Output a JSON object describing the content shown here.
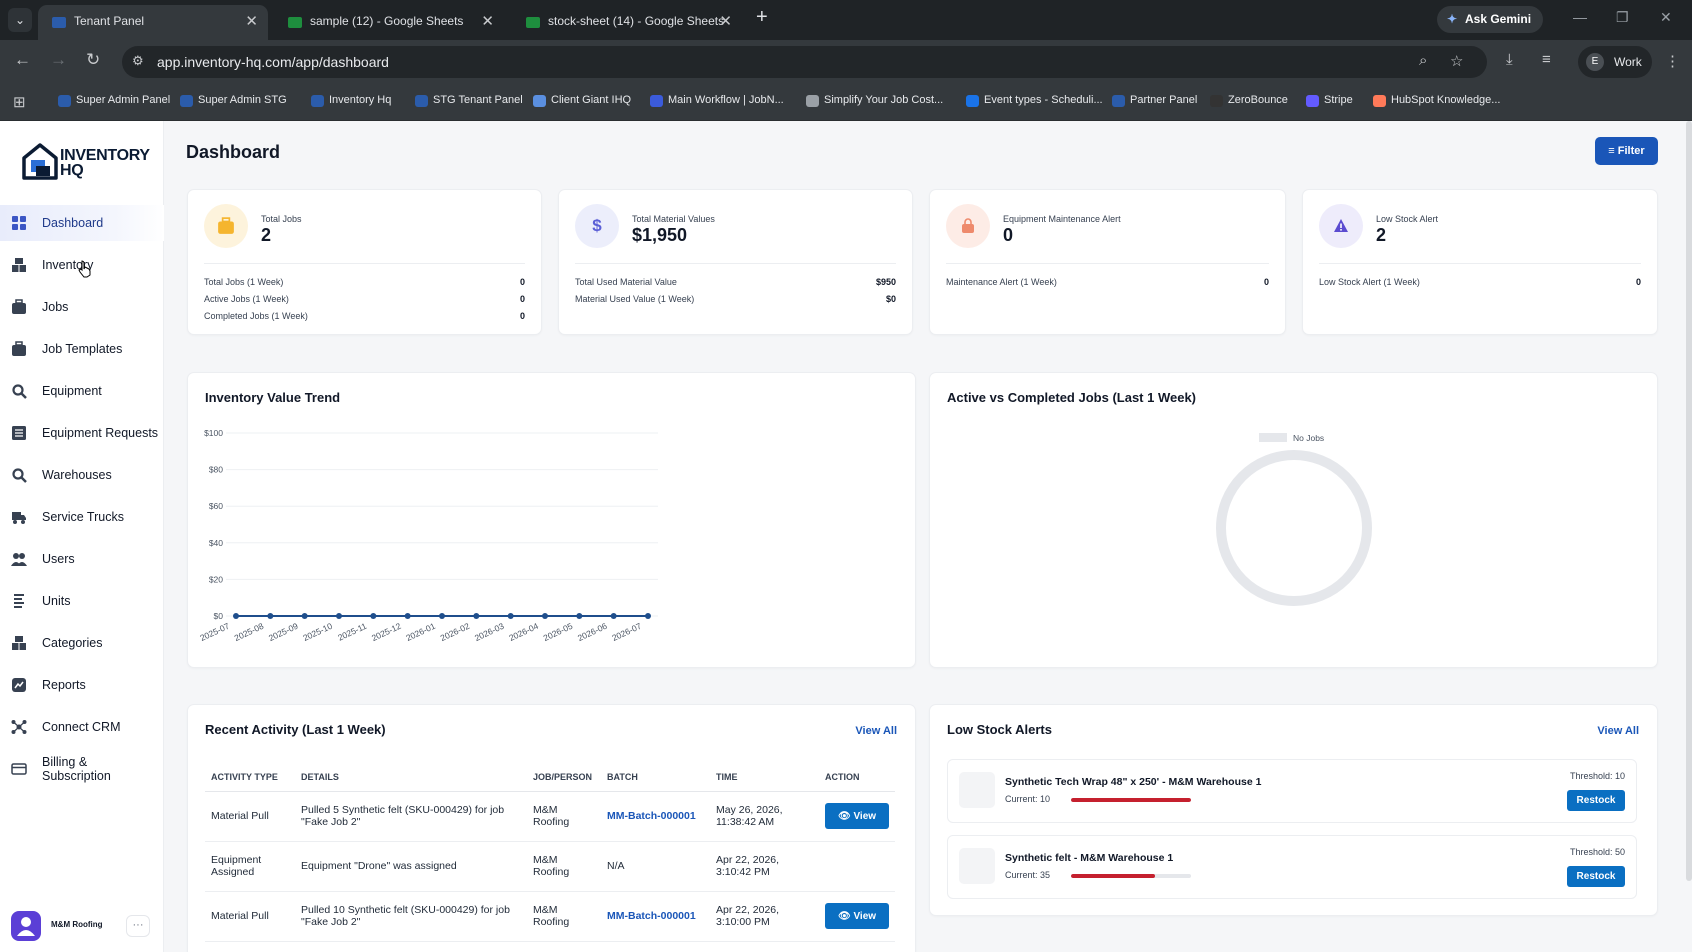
{
  "browser": {
    "tabs": [
      {
        "title": "Tenant Panel",
        "active": true,
        "favicon_color": "#2b5cab"
      },
      {
        "title": "sample (12) - Google Sheets",
        "active": false,
        "favicon_color": "#1e8e3e"
      },
      {
        "title": "stock-sheet (14) - Google Sheets",
        "active": false,
        "favicon_color": "#1e8e3e"
      }
    ],
    "ask_gemini": "Ask Gemini",
    "url": "app.inventory-hq.com/app/dashboard",
    "profile_initial": "E",
    "profile_label": "Work",
    "bookmarks": [
      {
        "label": "Super Admin Panel",
        "color": "#2b5cab"
      },
      {
        "label": "Super Admin STG",
        "color": "#2b5cab"
      },
      {
        "label": "Inventory Hq",
        "color": "#2b5cab"
      },
      {
        "label": "STG Tenant Panel",
        "color": "#2b5cab"
      },
      {
        "label": "Client Giant IHQ",
        "color": "#5a8fe0"
      },
      {
        "label": "Main Workflow | JobN...",
        "color": "#3b5bdb"
      },
      {
        "label": "Simplify Your Job Cost...",
        "color": "#9aa0a6"
      },
      {
        "label": "Event types - Scheduli...",
        "color": "#1a73e8"
      },
      {
        "label": "Partner Panel",
        "color": "#2b5cab"
      },
      {
        "label": "ZeroBounce",
        "color": "#333333"
      },
      {
        "label": "Stripe",
        "color": "#635bff"
      },
      {
        "label": "HubSpot Knowledge...",
        "color": "#ff7a59"
      }
    ]
  },
  "sidebar": {
    "logo_line1": "INVENTORY",
    "logo_line2": "HQ",
    "items": [
      {
        "label": "Dashboard",
        "icon": "grid-icon",
        "active": true
      },
      {
        "label": "Inventory",
        "icon": "boxes-icon",
        "active": false
      },
      {
        "label": "Jobs",
        "icon": "briefcase-icon",
        "active": false
      },
      {
        "label": "Job Templates",
        "icon": "briefcase-icon",
        "active": false
      },
      {
        "label": "Equipment",
        "icon": "gear-wrench-icon",
        "active": false
      },
      {
        "label": "Equipment Requests",
        "icon": "list-icon",
        "active": false
      },
      {
        "label": "Warehouses",
        "icon": "gear-wrench-icon",
        "active": false
      },
      {
        "label": "Service Trucks",
        "icon": "truck-icon",
        "active": false
      },
      {
        "label": "Users",
        "icon": "users-icon",
        "active": false
      },
      {
        "label": "Units",
        "icon": "units-icon",
        "active": false
      },
      {
        "label": "Categories",
        "icon": "boxes-icon",
        "active": false
      },
      {
        "label": "Reports",
        "icon": "chart-icon",
        "active": false
      },
      {
        "label": "Connect CRM",
        "icon": "connect-icon",
        "active": false
      },
      {
        "label": "Billing & Subscription",
        "icon": "card-icon",
        "active": false
      }
    ],
    "user_name": "M&M Roofing",
    "user_more": "···"
  },
  "header": {
    "title": "Dashboard",
    "filter_label": "Filter"
  },
  "stats": [
    {
      "label": "Total Jobs",
      "value": "2",
      "icon": "briefcase-icon",
      "icon_bg": "#fdf3dc",
      "icon_color": "#f5b52e",
      "rows": [
        {
          "label": "Total Jobs (1 Week)",
          "value": "0"
        },
        {
          "label": "Active Jobs (1 Week)",
          "value": "0"
        },
        {
          "label": "Completed Jobs (1 Week)",
          "value": "0"
        }
      ]
    },
    {
      "label": "Total Material Values",
      "value": "$1,950",
      "icon": "dollar-icon",
      "icon_bg": "#eceefb",
      "icon_color": "#5b5fd6",
      "rows": [
        {
          "label": "Total Used Material Value",
          "value": "$950"
        },
        {
          "label": "Material Used Value (1 Week)",
          "value": "$0"
        }
      ]
    },
    {
      "label": "Equipment Maintenance Alert",
      "value": "0",
      "icon": "bag-icon",
      "icon_bg": "#fdece6",
      "icon_color": "#ee8a6c",
      "rows": [
        {
          "label": "Maintenance Alert (1 Week)",
          "value": "0"
        }
      ]
    },
    {
      "label": "Low Stock Alert",
      "value": "2",
      "icon": "warning-icon",
      "icon_bg": "#eeecfb",
      "icon_color": "#5b4bd0",
      "rows": [
        {
          "label": "Low Stock Alert (1 Week)",
          "value": "0"
        }
      ]
    }
  ],
  "chart_data": [
    {
      "type": "line",
      "title": "Inventory Value Trend",
      "categories": [
        "2025-07",
        "2025-08",
        "2025-09",
        "2025-10",
        "2025-11",
        "2025-12",
        "2026-01",
        "2026-02",
        "2026-03",
        "2026-04",
        "2026-05",
        "2026-06",
        "2026-07"
      ],
      "series": [
        {
          "values": [
            0,
            0,
            0,
            0,
            0,
            0,
            0,
            0,
            0,
            0,
            0,
            0,
            0
          ]
        }
      ],
      "yticks": [
        "$0",
        "$20",
        "$40",
        "$60",
        "$80",
        "$100"
      ],
      "ylim": [
        0,
        100
      ],
      "grid": true,
      "color": "#1f4e8c"
    },
    {
      "type": "pie",
      "title": "Active vs Completed Jobs (Last 1 Week)",
      "legend": [
        "No Jobs"
      ],
      "values": [
        1
      ],
      "legend_position": "top",
      "color": "#e5e7eb"
    }
  ],
  "activity": {
    "title": "Recent Activity (Last 1 Week)",
    "view_all": "View All",
    "columns": [
      "ACTIVITY TYPE",
      "DETAILS",
      "JOB/PERSON",
      "BATCH",
      "TIME",
      "ACTION"
    ],
    "rows": [
      {
        "type": "Material Pull",
        "details": "Pulled 5 Synthetic felt (SKU-000429) for job \"Fake Job 2\"",
        "person": "M&M Roofing",
        "batch": "MM-Batch-000001",
        "time": "May 26, 2026, 11:38:42 AM",
        "action": "View"
      },
      {
        "type": "Equipment Assigned",
        "details": "Equipment \"Drone\" was assigned",
        "person": "M&M Roofing",
        "batch": "N/A",
        "time": "Apr 22, 2026, 3:10:42 PM",
        "action": ""
      },
      {
        "type": "Material Pull",
        "details": "Pulled 10 Synthetic felt (SKU-000429) for job \"Fake Job 2\"",
        "person": "M&M Roofing",
        "batch": "MM-Batch-000001",
        "time": "Apr 22, 2026, 3:10:00 PM",
        "action": "View"
      }
    ]
  },
  "low_stock": {
    "title": "Low Stock Alerts",
    "view_all": "View All",
    "items": [
      {
        "name": "Synthetic Tech Wrap 48\" x 250' - M&M Warehouse 1",
        "current_label": "Current: 10",
        "current": 10,
        "threshold_label": "Threshold: 10",
        "threshold": 10,
        "restock": "Restock"
      },
      {
        "name": "Synthetic felt - M&M Warehouse 1",
        "current_label": "Current: 35",
        "current": 35,
        "threshold_label": "Threshold: 50",
        "threshold": 50,
        "restock": "Restock"
      }
    ]
  }
}
